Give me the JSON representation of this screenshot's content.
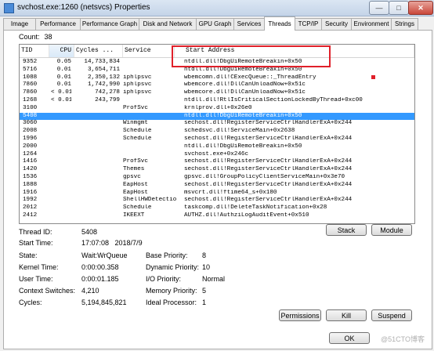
{
  "window": {
    "title": "svchost.exe:1260 (netsvcs) Properties",
    "min_label": "—",
    "max_label": "□",
    "close_label": "✕"
  },
  "tabs": [
    {
      "label": "Image"
    },
    {
      "label": "Performance"
    },
    {
      "label": "Performance Graph"
    },
    {
      "label": "Disk and Network"
    },
    {
      "label": "GPU Graph"
    },
    {
      "label": "Services"
    },
    {
      "label": "Threads"
    },
    {
      "label": "TCP/IP"
    },
    {
      "label": "Security"
    },
    {
      "label": "Environment"
    },
    {
      "label": "Strings"
    }
  ],
  "active_tab": "Threads",
  "count": {
    "label": "Count:",
    "value": "38"
  },
  "columns": {
    "tid": "TID",
    "cpu": "CPU",
    "cycles": "Cycles ...",
    "service": "Service",
    "start": "Start Address"
  },
  "rows": [
    {
      "tid": "9352",
      "cpu": "0.05",
      "cycles": "14,733,834",
      "service": "",
      "start": "ntdll.dll!DbgUiRemoteBreakin+0x50"
    },
    {
      "tid": "5716",
      "cpu": "0.01",
      "cycles": "3,654,711",
      "service": "",
      "start": "ntdll.dll!DbgUiRemoteBreakin+0x50"
    },
    {
      "tid": "1088",
      "cpu": "0.01",
      "cycles": "2,350,132",
      "service": "iphlpsvc",
      "start": "wbemcomn.dll!CExecQueue::_ThreadEntry"
    },
    {
      "tid": "7860",
      "cpu": "0.01",
      "cycles": "1,742,990",
      "service": "iphlpsvc",
      "start": "wbemcore.dll!DllCanUnloadNow+0x51c"
    },
    {
      "tid": "7860",
      "cpu": "< 0.01",
      "cycles": "742,278",
      "service": "iphlpsvc",
      "start": "wbemcore.dll!DllCanUnloadNow+0x51c"
    },
    {
      "tid": "1268",
      "cpu": "< 0.01",
      "cycles": "243,799",
      "service": "",
      "start": "ntdll.dll!RtlIsCriticalSectionLockedByThread+0xc00"
    },
    {
      "tid": "3100",
      "cpu": "",
      "cycles": "",
      "service": "ProfSvc",
      "start": "krnlprov.dll+0x26e0"
    },
    {
      "tid": "5408",
      "cpu": "",
      "cycles": "",
      "service": "",
      "start": "ntdll.dll!DbgUiRemoteBreakin+0x50"
    },
    {
      "tid": "3060",
      "cpu": "",
      "cycles": "",
      "service": "Winmgmt",
      "start": "sechost.dll!RegisterServiceCtrlHandlerExA+0x244"
    },
    {
      "tid": "2008",
      "cpu": "",
      "cycles": "",
      "service": "Schedule",
      "start": "schedsvc.dll!ServiceMain+0x2638"
    },
    {
      "tid": "1996",
      "cpu": "",
      "cycles": "",
      "service": "Schedule",
      "start": "sechost.dll!RegisterServiceCtrlHandlerExA+0x244"
    },
    {
      "tid": "2000",
      "cpu": "",
      "cycles": "",
      "service": "",
      "start": "ntdll.dll!DbgUiRemoteBreakin+0x50"
    },
    {
      "tid": "1264",
      "cpu": "",
      "cycles": "",
      "service": "",
      "start": "svchost.exe+0x246c"
    },
    {
      "tid": "1416",
      "cpu": "",
      "cycles": "",
      "service": "ProfSvc",
      "start": "sechost.dll!RegisterServiceCtrlHandlerExA+0x244"
    },
    {
      "tid": "1420",
      "cpu": "",
      "cycles": "",
      "service": "Themes",
      "start": "sechost.dll!RegisterServiceCtrlHandlerExA+0x244"
    },
    {
      "tid": "1536",
      "cpu": "",
      "cycles": "",
      "service": "gpsvc",
      "start": "gpsvc.dll!GroupPolicyClientServiceMain+0x3e70"
    },
    {
      "tid": "1888",
      "cpu": "",
      "cycles": "",
      "service": "EapHost",
      "start": "sechost.dll!RegisterServiceCtrlHandlerExA+0x244"
    },
    {
      "tid": "1916",
      "cpu": "",
      "cycles": "",
      "service": "EapHost",
      "start": "msvcrt.dll!ftime64_s+0x180"
    },
    {
      "tid": "1992",
      "cpu": "",
      "cycles": "",
      "service": "ShellHWDetection",
      "start": "sechost.dll!RegisterServiceCtrlHandlerExA+0x244"
    },
    {
      "tid": "2012",
      "cpu": "",
      "cycles": "",
      "service": "Schedule",
      "start": "taskcomp.dll!DeleteTaskNotification+0x28"
    },
    {
      "tid": "2412",
      "cpu": "",
      "cycles": "",
      "service": "IKEEXT",
      "start": "AUTHZ.dll!AuthziLogAuditEvent+0x510"
    }
  ],
  "selected_tid": "5408",
  "details": {
    "thread_id_label": "Thread ID:",
    "thread_id": "5408",
    "start_time_label": "Start Time:",
    "start_time": "17:07:08   2018/7/9",
    "state_label": "State:",
    "state": "Wait:WrQueue",
    "base_priority_label": "Base Priority:",
    "base_priority": "8",
    "kernel_time_label": "Kernel Time:",
    "kernel_time": "0:00:00.358",
    "dynamic_priority_label": "Dynamic Priority:",
    "dynamic_priority": "10",
    "user_time_label": "User Time:",
    "user_time": "0:00:01.185",
    "io_priority_label": "I/O Priority:",
    "io_priority": "Normal",
    "context_switches_label": "Context Switches:",
    "context_switches": "4,210",
    "memory_priority_label": "Memory Priority:",
    "memory_priority": "5",
    "cycles_label": "Cycles:",
    "cycles": "5,194,845,821",
    "ideal_processor_label": "Ideal Processor:",
    "ideal_processor": "1"
  },
  "buttons": {
    "stack": "Stack",
    "module": "Module",
    "permissions": "Permissions",
    "kill": "Kill",
    "suspend": "Suspend",
    "ok": "OK"
  },
  "watermark": "@51CTO博客"
}
